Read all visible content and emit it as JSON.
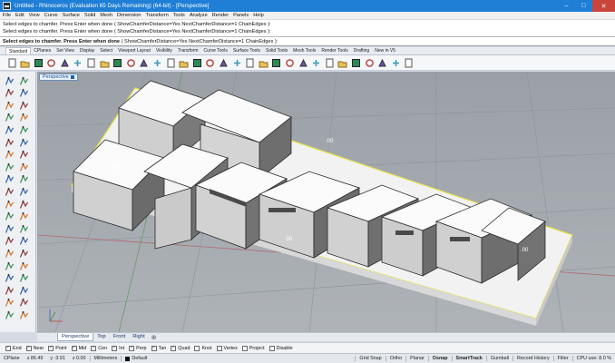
{
  "window": {
    "title": "Untitled - Rhinoceros (Evaluation 65 Days Remaining) (64-bit) - [Perspective]",
    "controls": [
      "–",
      "□",
      "✕"
    ]
  },
  "menu": [
    "File",
    "Edit",
    "View",
    "Curve",
    "Surface",
    "Solid",
    "Mesh",
    "Dimension",
    "Transform",
    "Tools",
    "Analyze",
    "Render",
    "Panels",
    "Help"
  ],
  "command": {
    "history": [
      "Select edges to chamfer. Press Enter when done ( ShowChamferDistance=Yes  NextChamferDistance=1  ChainEdges ):",
      "Select edges to chamfer. Press Enter when done ( ShowChamferDistance=Yes  NextChamferDistance=1  ChainEdges ):"
    ],
    "prompt": "Select edges to chamfer. Press Enter when done",
    "options": "( ShowChamferDistance=Yes  NextChamferDistance=1  ChainEdges ):"
  },
  "toolbar_tabs": [
    "Standard",
    "CPlanes",
    "Set View",
    "Display",
    "Select",
    "Viewport Layout",
    "Visibility",
    "Transform",
    "Curve Tools",
    "Surface Tools",
    "Solid Tools",
    "Mesh Tools",
    "Render Tools",
    "Drafting",
    "New in V5"
  ],
  "toolbar_icons": [
    "new-icon",
    "open-icon",
    "save-icon",
    "print-icon",
    "import-icon",
    "cut-icon",
    "copy-icon",
    "paste-icon",
    "undo-icon",
    "redo-icon",
    "pan-icon",
    "rotate-view-icon",
    "zoom-dynamic-icon",
    "zoom-window-icon",
    "zoom-extents-icon",
    "zoom-selected-icon",
    "undo-view-icon",
    "four-viewports-icon",
    "cplane-icon",
    "point-icon",
    "polyline-icon",
    "curve-icon",
    "layers-icon",
    "lights-icon",
    "material-icon",
    "render-icon",
    "display-mode-icon",
    "shade-icon",
    "options-icon",
    "help-icon",
    "history-icon"
  ],
  "viewport": {
    "label": "Perspective",
    "dims": [
      ".00",
      ".00",
      ".00",
      ".00"
    ]
  },
  "viewport_tabs": [
    "Perspective",
    "Top",
    "Front",
    "Right"
  ],
  "osnaps": [
    {
      "label": "End",
      "checked": true
    },
    {
      "label": "Near",
      "checked": true
    },
    {
      "label": "Point",
      "checked": true
    },
    {
      "label": "Mid",
      "checked": true
    },
    {
      "label": "Cen",
      "checked": true
    },
    {
      "label": "Int",
      "checked": true
    },
    {
      "label": "Perp",
      "checked": true
    },
    {
      "label": "Tan",
      "checked": true
    },
    {
      "label": "Quad",
      "checked": true
    },
    {
      "label": "Knot",
      "checked": false
    },
    {
      "label": "Vertex",
      "checked": false
    },
    {
      "label": "Project",
      "checked": false
    },
    {
      "label": "Disable",
      "checked": false
    }
  ],
  "status": {
    "cplane": "CPlane",
    "x": "x 86.49",
    "y": "y -3.91",
    "z": "z 0.00",
    "units": "Millimeters",
    "layer": "Default",
    "toggles": [
      "Grid Snap",
      "Ortho",
      "Planar",
      "Osnap",
      "SmartTrack",
      "Gumball",
      "Record History",
      "Filter"
    ],
    "cpu": "CPU use: 8.0 %"
  }
}
